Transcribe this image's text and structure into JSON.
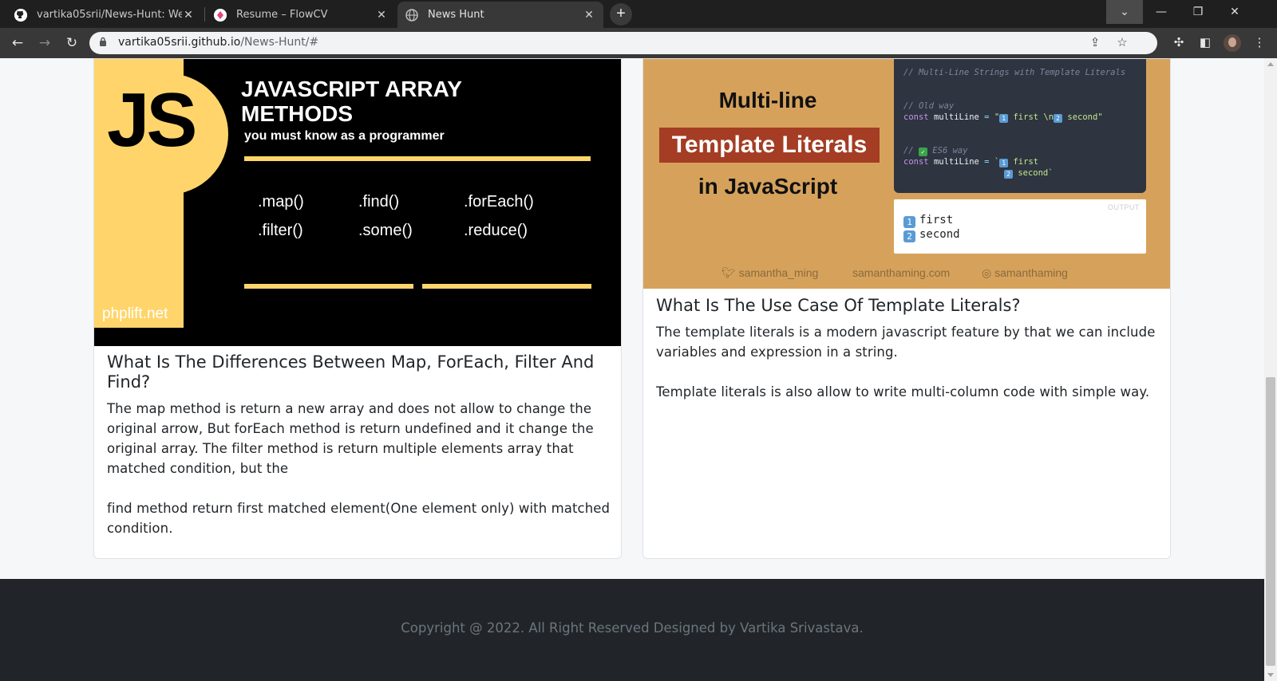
{
  "browser": {
    "tabs": [
      {
        "title": "vartika05srii/News-Hunt: Web-ap",
        "favicon": "github-icon"
      },
      {
        "title": "Resume – FlowCV",
        "favicon": "flowcv-icon"
      },
      {
        "title": "News Hunt",
        "favicon": "globe-icon",
        "active": true
      }
    ],
    "url_host": "vartika05srii.github.io",
    "url_path": "/News-Hunt/#"
  },
  "cards": [
    {
      "image": {
        "logo": "JS",
        "heading_line1": "JAVASCRIPT ARRAY",
        "heading_line2": "METHODS",
        "subheading": "you must know as a programmer",
        "methods": [
          ".map()",
          ".find()",
          ".forEach()",
          ".filter()",
          ".some()",
          ".reduce()"
        ],
        "site": "phplift.net"
      },
      "title": "What Is The Differences Between Map, ForEach, Filter And Find?",
      "paragraphs": [
        "The map method is return a new array and does not allow to change the original arrow, But forEach method is return undefined and it change the original array. The filter method is return multiple elements array that matched condition, but the",
        "find method return first matched element(One element only) with matched condition."
      ]
    },
    {
      "image": {
        "line1": "Multi-line",
        "line2": "Template Literals",
        "line3": "in JavaScript",
        "code_comment1": "// Multi-Line Strings with Template Literals",
        "code_comment2": "// Old way",
        "code_comment3": "ES6 way",
        "kw": "const",
        "var": "multiLine",
        "eq": "=",
        "str_old_a": "\"",
        "str_old_b": "first \\n",
        "str_old_c": "second\"",
        "str_new_a": "`",
        "str_new_b": "first",
        "str_new_c": "second`",
        "output_label": "OUTPUT",
        "output_line1": "first",
        "output_line2": "second",
        "emoji_1": "1",
        "emoji_2": "2",
        "check": "✓",
        "twitter": "samantha_ming",
        "website": "samanthaming.com",
        "instagram": "samanthaming"
      },
      "title": "What Is The Use Case Of Template Literals?",
      "paragraphs": [
        "The template literals is a modern javascript feature by that we can include variables and expression in a string.",
        "Template literals is also allow to write multi-column code with simple way."
      ]
    }
  ],
  "footer": {
    "copyright": "Copyright @ 2022. All Right Reserved Designed by Vartika Srivastava."
  },
  "colors": {
    "accent_yellow": "#ffd56b",
    "template_bg": "#d6a25b",
    "template_red": "#a43d24",
    "footer_bg": "#212529"
  }
}
